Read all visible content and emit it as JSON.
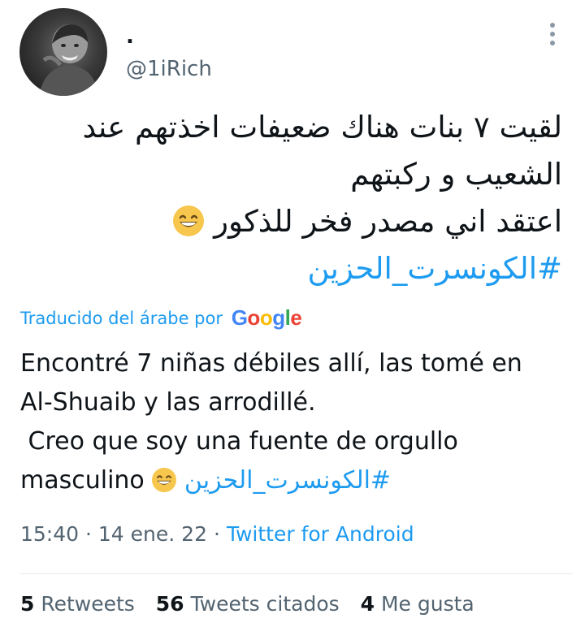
{
  "author": {
    "display_name": ".",
    "handle": "@1iRich"
  },
  "tweet": {
    "arabic_lines": [
      "لقيت ٧ بنات هناك ضعيفات اخذتهم عند",
      "الشعيب و ركبتهم",
      "اعتقد اني مصدر فخر للذكور"
    ],
    "hashtag": "#الكونسرت_الحزين",
    "emoji": "grinning-smiling-eyes-emoji"
  },
  "translation": {
    "attribution": "Traducido del árabe por",
    "provider": "Google",
    "provider_colors": [
      "#4285f4",
      "#ea4335",
      "#fbbc05",
      "#4285f4",
      "#34a853",
      "#ea4335"
    ],
    "lines": [
      "Encontré 7 niñas débiles allí, las tomé en",
      "Al-Shuaib y las arrodillé.",
      " Creo que soy una fuente de orgullo"
    ],
    "last_line_text": "masculino",
    "hashtag": "الكونسرت_الحزين#"
  },
  "meta": {
    "time": "15:40",
    "separator": "·",
    "date": "14 ene. 22",
    "source": "Twitter for Android"
  },
  "stats": {
    "retweets_count": "5",
    "retweets_label": "Retweets",
    "quotes_count": "56",
    "quotes_label": "Tweets citados",
    "likes_count": "4",
    "likes_label": "Me gusta"
  },
  "colors": {
    "link": "#1d9bf0",
    "secondary_text": "#536471",
    "primary_text": "#0f1419"
  }
}
